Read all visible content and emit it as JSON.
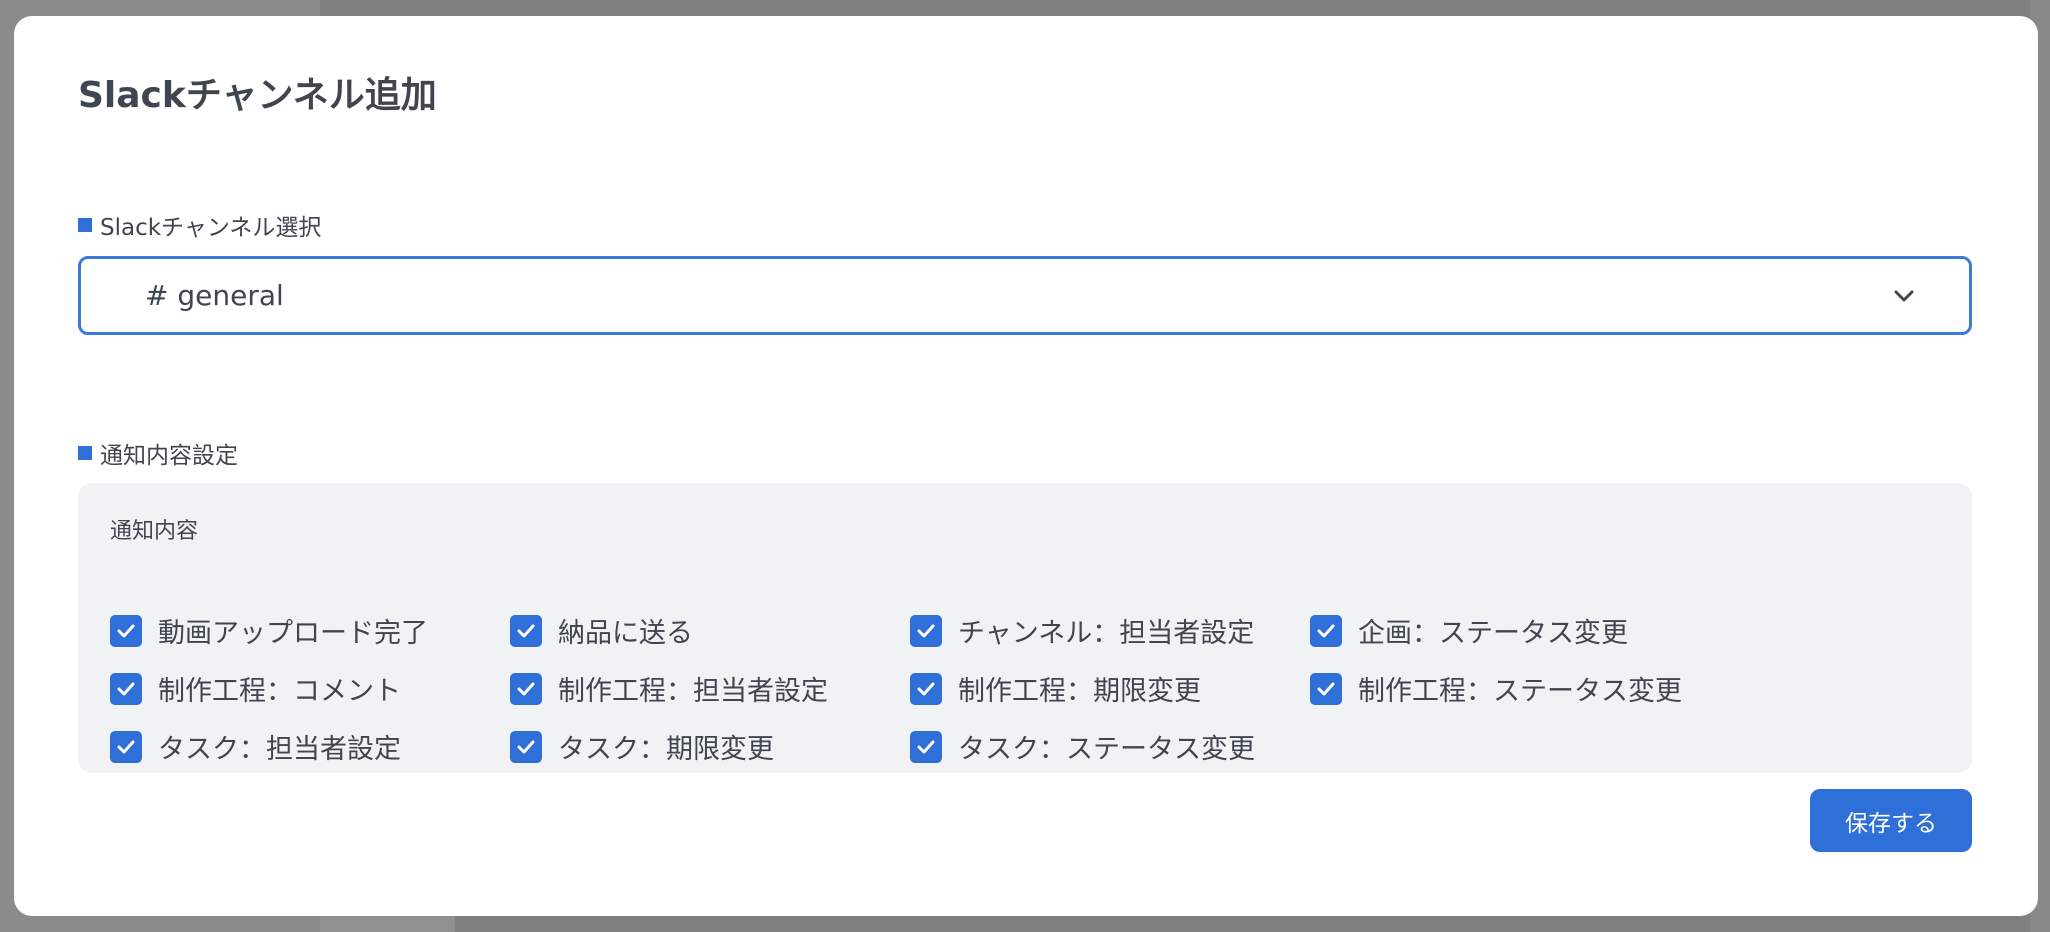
{
  "modal": {
    "title": "Slackチャンネル追加",
    "save_label": "保存する"
  },
  "channel_section": {
    "label": "Slackチャンネル選択",
    "selected_value": "# general"
  },
  "notify_section": {
    "label": "通知内容設定",
    "box_title": "通知内容",
    "checkboxes": [
      {
        "label": "動画アップロード完了",
        "checked": true
      },
      {
        "label": "納品に送る",
        "checked": true
      },
      {
        "label": "チャンネル：担当者設定",
        "checked": true
      },
      {
        "label": "企画：ステータス変更",
        "checked": true
      },
      {
        "label": "制作工程：コメント",
        "checked": true
      },
      {
        "label": "制作工程：担当者設定",
        "checked": true
      },
      {
        "label": "制作工程：期限変更",
        "checked": true
      },
      {
        "label": "制作工程：ステータス変更",
        "checked": true
      },
      {
        "label": "タスク：担当者設定",
        "checked": true
      },
      {
        "label": "タスク：期限変更",
        "checked": true
      },
      {
        "label": "タスク：ステータス変更",
        "checked": true
      }
    ]
  },
  "colors": {
    "accent": "#2f6fd8",
    "text": "#3f4650",
    "box_background": "#f1f2f4"
  },
  "icons": {
    "select_chevron": "chevron-down-icon",
    "checkbox": "checkmark-icon"
  }
}
